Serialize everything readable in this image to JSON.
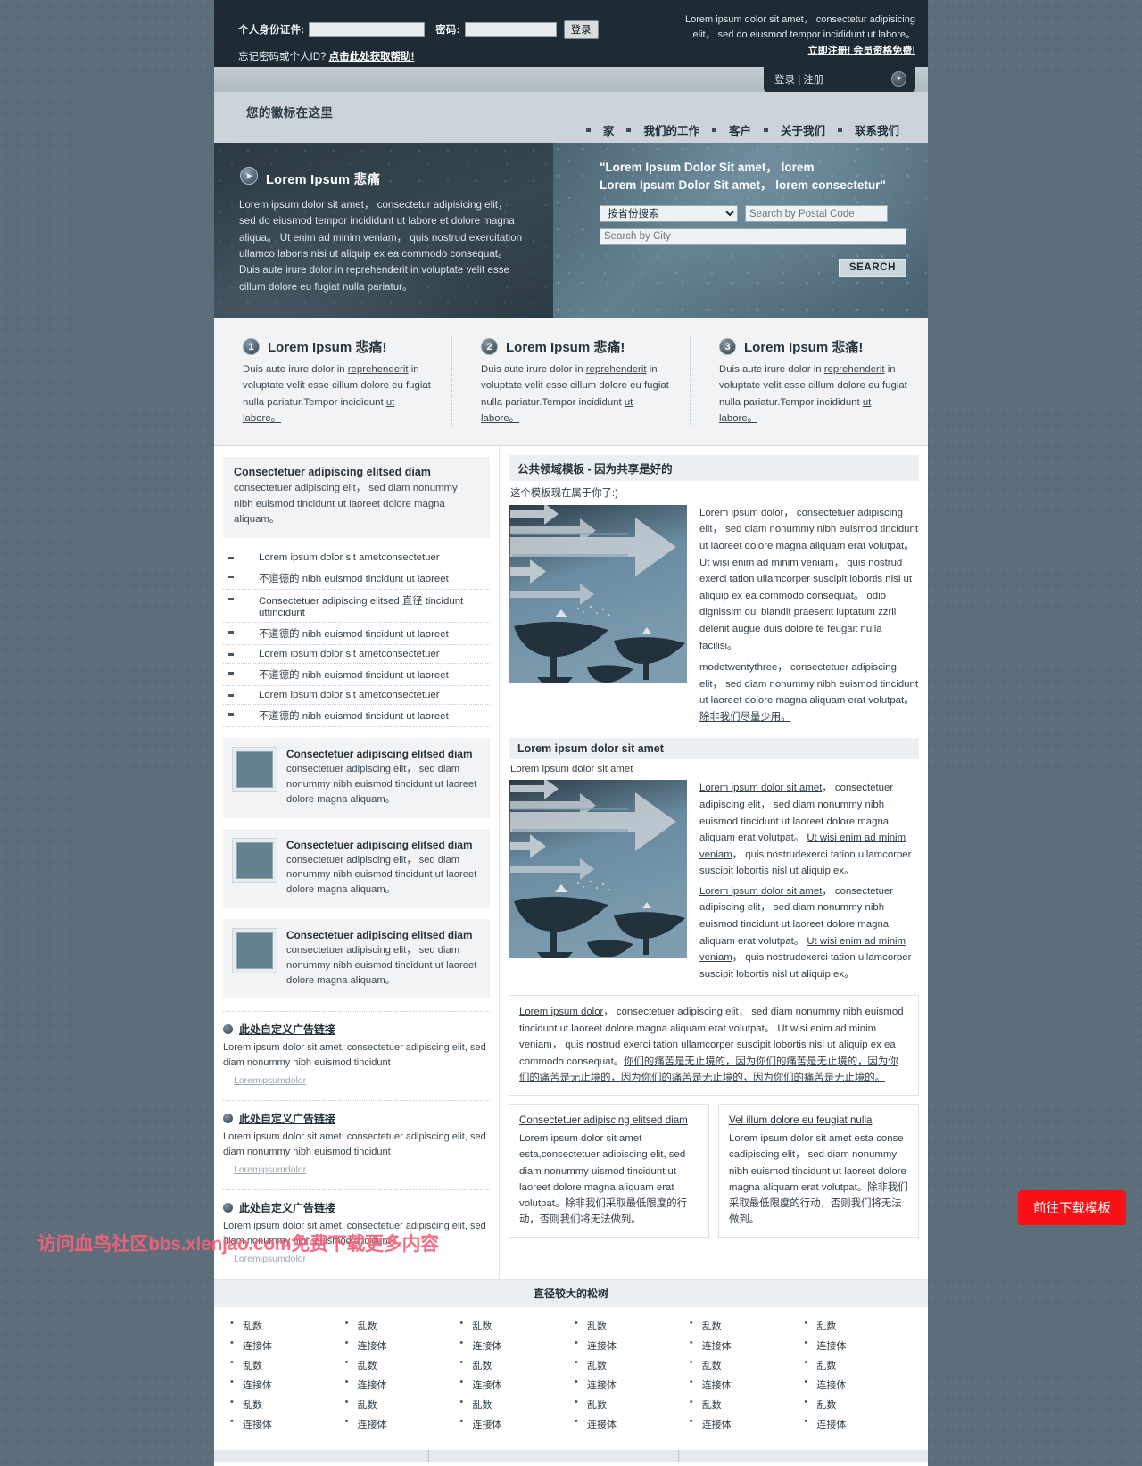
{
  "login": {
    "id_label": "个人身份证件:",
    "id_value": "",
    "pw_label": "密码:",
    "pw_value": "",
    "submit": "登录",
    "forgot_text": "忘记密码或个人ID?",
    "forgot_link": "点击此处获取帮助!",
    "promo_line1": "Lorem ipsum dolor sit amet， consectetur adipisicing elit， sed do eiusmod tempor incididunt ut labore。",
    "promo_line2": "立即注册! 会员资格免费!"
  },
  "subbar": {
    "account_link": "登录 | 注册",
    "chevron_icon": "▼"
  },
  "header": {
    "logo": "您的徽标在这里",
    "nav": [
      "家",
      "我们的工作",
      "客户",
      "关于我们",
      "联系我们"
    ]
  },
  "hero": {
    "play_icon": "➤",
    "title": "Lorem Ipsum 悲痛",
    "body": "Lorem ipsum dolor sit amet， consectetur adipisicing elit， sed do eiusmod tempor incididunt ut labore et dolore magna aliqua。 Ut enim ad minim veniam， quis nostrud exercitation ullamco laboris nisi ut aliquip ex ea commodo consequat。 Duis aute irure dolor in reprehenderit in voluptate velit esse cillum dolore eu fugiat nulla pariatur。",
    "quote_line1": "\"Lorem Ipsum Dolor Sit amet， lorem",
    "quote_line2": "Lorem Ipsum Dolor Sit amet， lorem consectetur\"",
    "province_selected": "按省份搜索",
    "province_options": [
      "按省份搜索"
    ],
    "postal_placeholder": "Search by Postal Code",
    "city_placeholder": "Search by City",
    "search_button": "SEARCH"
  },
  "promos": [
    {
      "num": "1",
      "title": "Lorem Ipsum 悲痛!",
      "p1": "Duis aute irure dolor in ",
      "link1": "reprehenderit",
      "p2": " in voluptate velit esse cillum dolore eu fugiat nulla pariatur.Tempor incididunt ",
      "link2": "ut labore。"
    },
    {
      "num": "2",
      "title": "Lorem Ipsum 悲痛!",
      "p1": "Duis aute irure dolor in ",
      "link1": "reprehenderit",
      "p2": " in voluptate velit esse cillum dolore eu fugiat nulla pariatur.Tempor incididunt ",
      "link2": "ut labore。"
    },
    {
      "num": "3",
      "title": "Lorem Ipsum 悲痛!",
      "p1": "Duis aute irure dolor in ",
      "link1": "reprehenderit",
      "p2": " in voluptate velit esse cillum dolore eu fugiat nulla pariatur.Tempor incididunt ",
      "link2": "ut labore。"
    }
  ],
  "sidebar": {
    "intro_title": "Consectetuer adipiscing elitsed diam",
    "intro_body": "consectetuer adipiscing elit， sed diam nonummy nibh euismod tincidunt ut laoreet dolore magna aliquam。",
    "list": [
      "Lorem ipsum dolor sit ametconsectetuer",
      "不道德的 nibh euismod tincidunt ut laoreet",
      "Consectetuer adipiscing elitsed 直径 tincidunt uttincidunt",
      "不道德的 nibh euismod tincidunt ut laoreet",
      "Lorem ipsum dolor sit ametconsectetuer",
      "不道德的 nibh euismod tincidunt ut laoreet",
      "Lorem ipsum dolor sit ametconsectetuer",
      "不道德的 nibh euismod tincidunt ut laoreet"
    ],
    "minis": [
      {
        "title": "Consectetuer adipiscing elitsed diam",
        "body": "consectetuer adipiscing elit， sed diam nonummy nibh euismod tincidunt ut laoreet dolore magna aliquam。"
      },
      {
        "title": "Consectetuer adipiscing elitsed diam",
        "body": "consectetuer adipiscing elit， sed diam nonummy nibh euismod tincidunt ut laoreet dolore magna aliquam。"
      },
      {
        "title": "Consectetuer adipiscing elitsed diam",
        "body": "consectetuer adipiscing elit， sed diam nonummy nibh euismod tincidunt ut laoreet dolore magna aliquam。"
      }
    ],
    "ads": [
      {
        "link": "此处自定义广告链接",
        "body": "Lorem ipsum dolor sit amet, consectetuer adipiscing elit, sed diam nonummy nibh euismod tincidunt",
        "small": "Loremipsumdolor"
      },
      {
        "link": "此处自定义广告链接",
        "body": "Lorem ipsum dolor sit amet, consectetuer adipiscing elit, sed diam nonummy nibh euismod tincidunt",
        "small": "Loremipsumdolor"
      },
      {
        "link": "此处自定义广告链接",
        "body": "Lorem ipsum dolor sit amet, consectetuer adipiscing elit, sed diam nonummy nibh euismod tincidunt",
        "small": "Loremipsumdolor"
      }
    ]
  },
  "article1": {
    "heading": "公共领域模板 - 因为共享是好的",
    "subline": "这个模板现在属于你了:)",
    "body": "Lorem ipsum dolor， consectetuer adipiscing elit， sed diam nonummy nibh euismod tincidunt ut laoreet dolore magna aliquam erat volutpat。 Ut wisi enim ad minim veniam， quis nostrud exerci tation ullamcorper suscipit lobortis nisl ut aliquip ex ea commodo consequat。 odio dignissim qui blandit praesent luptatum zzril delenit augue duis dolore te feugait nulla facilisi。",
    "body2": "modetwentythree， consectetuer adipiscing elit， sed diam nonummy nibh euismod tincidunt ut laoreet dolore magna aliquam erat volutpat。",
    "body2_link": "除非我们尽量少用。"
  },
  "article2": {
    "heading": "Lorem ipsum dolor sit amet",
    "subline": "Lorem ipsum dolor sit amet",
    "para1_link1": "Lorem ipsum dolor sit amet",
    "para1_a": "， consectetuer adipiscing elit， sed diam nonummy nibh euismod tincidunt ut laoreet dolore magna aliquam erat volutpat。 ",
    "para1_link2": "Ut wisi enim ad minim veniam",
    "para1_b": "， quis nostrudexerci tation ullamcorper suscipit lobortis nisl ut aliquip ex。",
    "para2_link1": "Lorem ipsum dolor sit amet",
    "para2_a": "， consectetuer adipiscing elit， sed diam nonummy nibh euismod tincidunt ut laoreet dolore magna aliquam erat volutpat。 ",
    "para2_link2": "Ut wisi enim ad minim veniam",
    "para2_b": "， quis nostrudexerci tation ullamcorper suscipit lobortis nisl ut aliquip ex。"
  },
  "note": {
    "link": "Lorem ipsum dolor",
    "text": "， consectetuer adipiscing elit， sed diam nonummy nibh euismod tincidunt ut laoreet dolore magna aliquam erat volutpat。 Ut wisi enim ad minim veniam， quis nostrud exerci tation ullamcorper suscipit lobortis nisl ut aliquip ex ea commodo consequat。",
    "cn": "你们的痛苦是无止境的，因为你们的痛苦是无止境的，因为你们的痛苦是无止境的，因为你们的痛苦是无止境的，因为你们的痛苦是无止境的。"
  },
  "duo": [
    {
      "title": "Consectetuer adipiscing elitsed diam",
      "body": "Lorem ipsum dolor sit amet esta,consectetuer adipiscing elit, sed diam nonummy uismod tincidunt ut laoreet dolore magna aliquam erat volutpat。除非我们采取最低限度的行动，否则我们将无法做到。"
    },
    {
      "title": "Vel illum dolore eu feugiat nulla",
      "body": "Lorem ipsum dolor sit amet esta conse cadipiscing elit， sed diam nonummy nibh euismod tincidunt ut laoreet dolore magna aliquam erat volutpat。除非我们采取最低限度的行动，否则我们将无法做到。"
    }
  ],
  "footer": {
    "heading": "直径较大的松树",
    "columns": [
      [
        "乱数",
        "连接体",
        "乱数",
        "连接体",
        "乱数",
        "连接体"
      ],
      [
        "乱数",
        "连接体",
        "乱数",
        "连接体",
        "乱数",
        "连接体"
      ],
      [
        "乱数",
        "连接体",
        "乱数",
        "连接体",
        "乱数",
        "连接体"
      ],
      [
        "乱数",
        "连接体",
        "乱数",
        "连接体",
        "乱数",
        "连接体"
      ],
      [
        "乱数",
        "连接体",
        "乱数",
        "连接体",
        "乱数",
        "连接体"
      ],
      [
        "乱数",
        "连接体",
        "乱数",
        "连接体",
        "乱数",
        "连接体"
      ]
    ]
  },
  "overlay": {
    "watermark": "访问血鸟社区bbs.xlenjao.com免费下载更多内容",
    "download_button": "前往下载模板",
    "accent_red": "#fa0f17",
    "watermark_color": "#f4617a"
  }
}
